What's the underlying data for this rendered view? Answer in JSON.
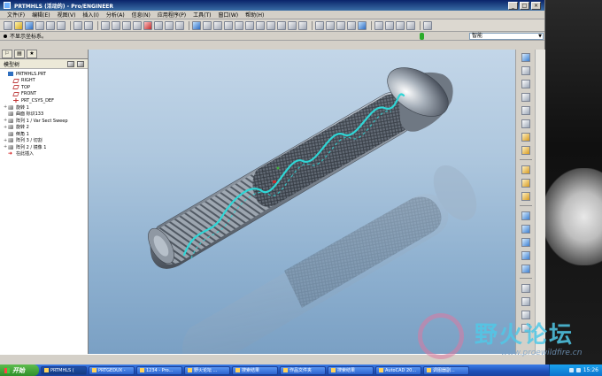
{
  "window": {
    "title": "PRTMHLS (活动的) - Pro/ENGINEER",
    "buttons": {
      "minimize": "_",
      "maximize": "□",
      "close": "×"
    }
  },
  "menu": [
    "文件(F)",
    "编辑(E)",
    "视图(V)",
    "插入(I)",
    "分析(A)",
    "信息(N)",
    "应用程序(P)",
    "工具(T)",
    "窗口(W)",
    "帮助(H)"
  ],
  "status_message": "不显示坐标系。",
  "filter": {
    "value": "智能"
  },
  "navigator": {
    "title": "模型树",
    "tabs": [
      "⚐",
      "▤",
      "★"
    ],
    "tree": [
      {
        "label": "PRTMHLS.PRT",
        "icon": "part-icon",
        "expand": ""
      },
      {
        "label": "RIGHT",
        "icon": "datum-plane-icon",
        "expand": ""
      },
      {
        "label": "TOP",
        "icon": "datum-plane-icon",
        "expand": ""
      },
      {
        "label": "FRONT",
        "icon": "datum-plane-icon",
        "expand": ""
      },
      {
        "label": "PRT_CSYS_DEF",
        "icon": "csys-icon",
        "expand": ""
      },
      {
        "label": "旋转 1",
        "icon": "revolve-icon",
        "expand": "+"
      },
      {
        "label": "曲面 标识133",
        "icon": "surface-icon",
        "expand": ""
      },
      {
        "label": "阵列 1 / Var Sect Sweep",
        "icon": "pattern-icon",
        "expand": "+"
      },
      {
        "label": "旋转 2",
        "icon": "revolve-icon",
        "expand": "+"
      },
      {
        "label": "倒角 1",
        "icon": "chamfer-icon",
        "expand": ""
      },
      {
        "label": "阵列 3 / 切割",
        "icon": "pattern-icon",
        "expand": "+"
      },
      {
        "label": "阵列 2 / 镜像 1",
        "icon": "pattern-icon",
        "expand": "+"
      },
      {
        "label": "在此插入",
        "icon": "insert-here-icon",
        "expand": ""
      }
    ]
  },
  "taskbar": {
    "start": "开始",
    "tasks": [
      "PRTMHLS (",
      "PRTGEDUX -",
      "1234 - Pro...",
      "野火论坛 ...",
      "搜索结果",
      "作品文件夹",
      "搜索结果",
      "AutoCAD 20...",
      "调图器副..."
    ],
    "clock": "15:26"
  },
  "watermark": {
    "text": "野火论坛",
    "url": "www.proewildfire.cn"
  },
  "colors": {
    "viewport_top": "#c3d6e8",
    "viewport_bottom": "#7aa0c4",
    "helix": "#2fd6d6",
    "title_bar": "#0a246a"
  }
}
